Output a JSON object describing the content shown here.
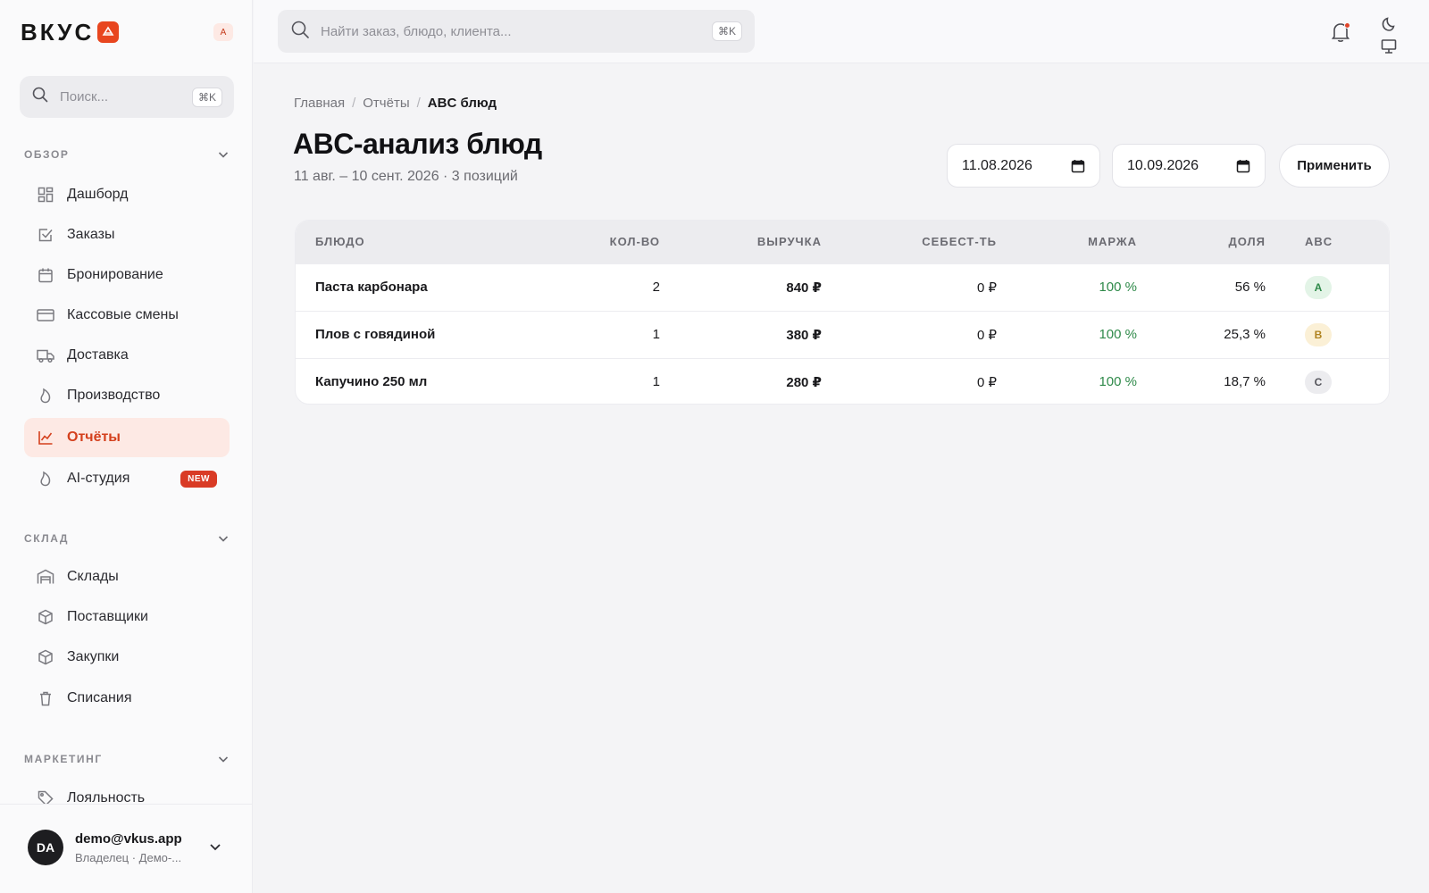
{
  "brand": {
    "name": "ВКУС",
    "badge": "A"
  },
  "sidebar": {
    "search_placeholder": "Поиск...",
    "search_shortcut": "⌘K",
    "sections": [
      {
        "title": "ОБЗОР",
        "items": [
          {
            "label": "Дашборд",
            "icon": "dashboard-icon"
          },
          {
            "label": "Заказы",
            "icon": "checkbox-icon"
          },
          {
            "label": "Бронирование",
            "icon": "calendar-icon"
          },
          {
            "label": "Кассовые смены",
            "icon": "card-icon"
          },
          {
            "label": "Доставка",
            "icon": "truck-icon"
          },
          {
            "label": "Производство",
            "icon": "flame-icon"
          },
          {
            "label": "Отчёты",
            "icon": "chart-icon",
            "active": true
          },
          {
            "label": "AI-студия",
            "icon": "flame-icon",
            "badge": "NEW"
          }
        ]
      },
      {
        "title": "СКЛАД",
        "items": [
          {
            "label": "Склады",
            "icon": "warehouse-icon"
          },
          {
            "label": "Поставщики",
            "icon": "box-icon"
          },
          {
            "label": "Закупки",
            "icon": "box-icon"
          },
          {
            "label": "Списания",
            "icon": "trash-icon"
          }
        ]
      },
      {
        "title": "МАРКЕТИНГ",
        "items": [
          {
            "label": "Лояльность",
            "icon": "tag-icon"
          }
        ]
      }
    ]
  },
  "user": {
    "initials": "DA",
    "email": "demo@vkus.app",
    "role": "Владелец · Демо-..."
  },
  "topbar": {
    "search_placeholder": "Найти заказ, блюдо, клиента...",
    "search_shortcut": "⌘K"
  },
  "breadcrumbs": [
    "Главная",
    "Отчёты",
    "ABC блюд"
  ],
  "page": {
    "title": "ABC-анализ блюд",
    "subtitle": "11 авг. – 10 сент. 2026 · 3 позиций",
    "date_from": "11.08.2026",
    "date_to": "10.09.2026",
    "apply_label": "Применить"
  },
  "table": {
    "columns": [
      "БЛЮДО",
      "КОЛ-ВО",
      "ВЫРУЧКА",
      "СЕБЕСТ-ТЬ",
      "МАРЖА",
      "ДОЛЯ",
      "ABC"
    ],
    "rows": [
      {
        "name": "Паста карбонара",
        "qty": "2",
        "revenue": "840 ₽",
        "cost": "0 ₽",
        "margin": "100 %",
        "share": "56 %",
        "abc": "A"
      },
      {
        "name": "Плов с говядиной",
        "qty": "1",
        "revenue": "380 ₽",
        "cost": "0 ₽",
        "margin": "100 %",
        "share": "25,3 %",
        "abc": "B"
      },
      {
        "name": "Капучино 250 мл",
        "qty": "1",
        "revenue": "280 ₽",
        "cost": "0 ₽",
        "margin": "100 %",
        "share": "18,7 %",
        "abc": "C"
      }
    ]
  },
  "colors": {
    "accent": "#d4401d",
    "abc_a_bg": "#e3f4e7",
    "abc_a_fg": "#2f8a4a",
    "abc_b_bg": "#fbf0d6",
    "abc_b_fg": "#b08320",
    "abc_c_bg": "#ececef",
    "abc_c_fg": "#55555c"
  }
}
